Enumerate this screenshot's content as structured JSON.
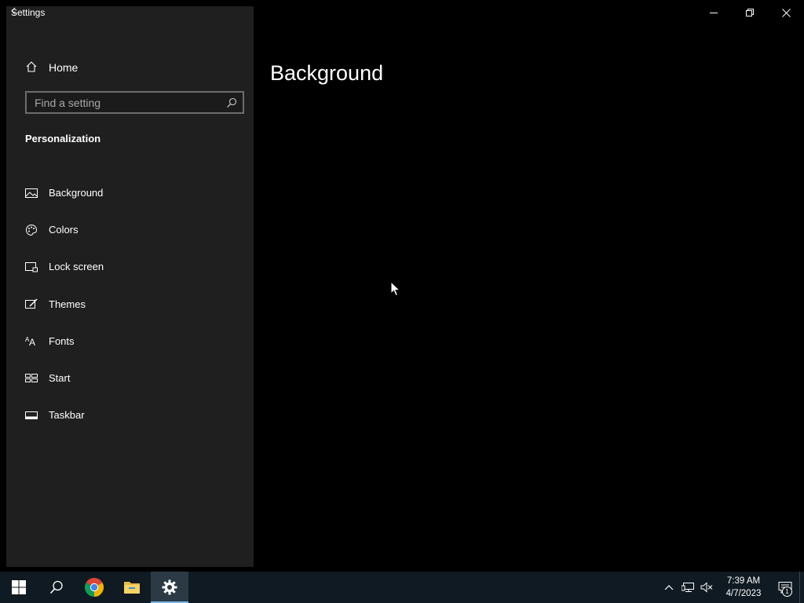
{
  "window": {
    "title": "Settings",
    "caption": {
      "minimize": "minimize-icon",
      "restore": "restore-icon",
      "close": "close-icon"
    }
  },
  "sidebar": {
    "home_label": "Home",
    "search": {
      "placeholder": "Find a setting",
      "value": ""
    },
    "section_title": "Personalization",
    "items": [
      {
        "label": "Background",
        "icon": "picture-icon"
      },
      {
        "label": "Colors",
        "icon": "palette-icon"
      },
      {
        "label": "Lock screen",
        "icon": "lock-screen-icon"
      },
      {
        "label": "Themes",
        "icon": "themes-icon"
      },
      {
        "label": "Fonts",
        "icon": "fonts-icon"
      },
      {
        "label": "Start",
        "icon": "start-icon"
      },
      {
        "label": "Taskbar",
        "icon": "taskbar-icon"
      }
    ]
  },
  "main": {
    "page_title": "Background"
  },
  "taskbar": {
    "apps": [
      "windows-start-icon",
      "search-icon",
      "chrome-icon",
      "file-explorer-icon",
      "settings-icon"
    ],
    "clock": {
      "time": "7:39 AM",
      "date": "4/7/2023"
    },
    "notification_count": "1"
  },
  "colors": {
    "accent": "#76b9ed",
    "sidebar_bg": "#1f1f1f",
    "taskbar_bg": "#0f1a22"
  }
}
